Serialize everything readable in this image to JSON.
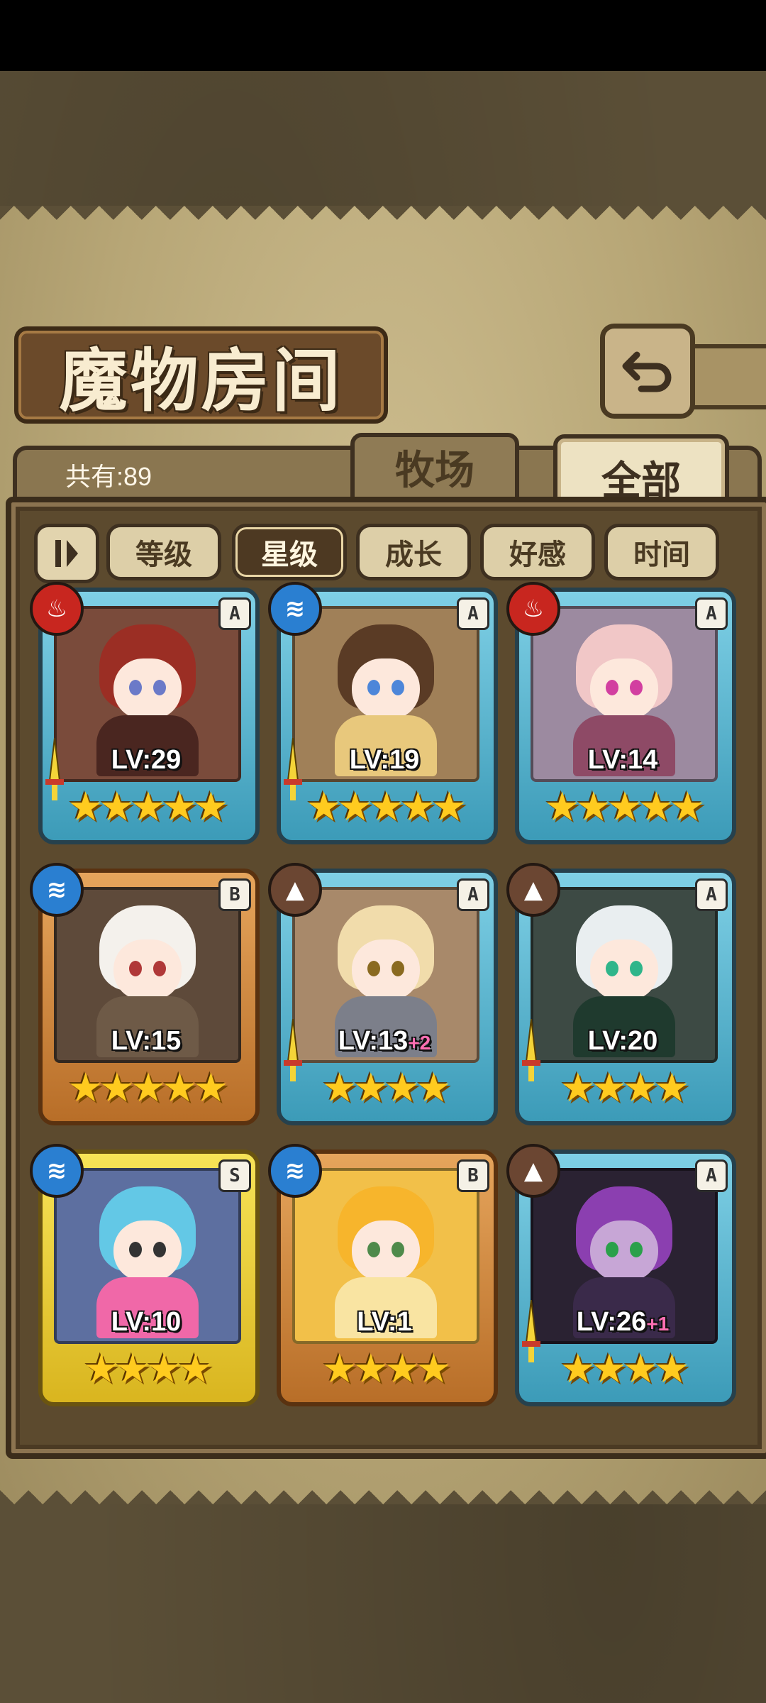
{
  "title": "魔物房间",
  "count": "共有:89",
  "tabs": [
    {
      "label": "牧场",
      "active": false
    },
    {
      "label": "全部",
      "active": true
    }
  ],
  "sort": [
    {
      "label": "等级",
      "active": false
    },
    {
      "label": "星级",
      "active": true
    },
    {
      "label": "成长",
      "active": false
    },
    {
      "label": "好感",
      "active": false
    },
    {
      "label": "时间",
      "active": false
    }
  ],
  "monsters": [
    {
      "level": "LV:29",
      "bonus": "",
      "rank": "A",
      "element": "fire-icon",
      "stars": 5,
      "stars_text": "★★★★★",
      "weapon": true
    },
    {
      "level": "LV:19",
      "bonus": "",
      "rank": "A",
      "element": "water-icon",
      "stars": 5,
      "stars_text": "★★★★★",
      "weapon": true
    },
    {
      "level": "LV:14",
      "bonus": "",
      "rank": "A",
      "element": "fire-icon",
      "stars": 5,
      "stars_text": "★★★★★",
      "weapon": false
    },
    {
      "level": "LV:15",
      "bonus": "",
      "rank": "B",
      "element": "water-icon",
      "stars": 5,
      "stars_text": "★★★★★",
      "weapon": false
    },
    {
      "level": "LV:13",
      "bonus": "+2",
      "rank": "A",
      "element": "earth-icon",
      "stars": 4,
      "stars_text": "★★★★",
      "weapon": true
    },
    {
      "level": "LV:20",
      "bonus": "",
      "rank": "A",
      "element": "earth-icon",
      "stars": 4,
      "stars_text": "★★★★",
      "weapon": true
    },
    {
      "level": "LV:10",
      "bonus": "",
      "rank": "S",
      "element": "water-icon",
      "stars": 4,
      "stars_text": "★★★★",
      "weapon": false
    },
    {
      "level": "LV:1",
      "bonus": "",
      "rank": "B",
      "element": "water-icon",
      "stars": 4,
      "stars_text": "★★★★",
      "weapon": false
    },
    {
      "level": "LV:26",
      "bonus": "+1",
      "rank": "A",
      "element": "earth-icon",
      "stars": 4,
      "stars_text": "★★★★",
      "weapon": true
    }
  ]
}
